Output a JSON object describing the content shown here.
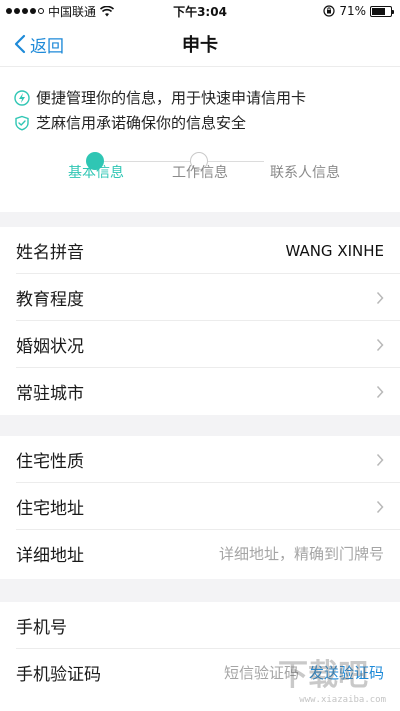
{
  "status_bar": {
    "carrier": "中国联通",
    "time": "下午3:04",
    "battery_percent": "71%",
    "battery_level": 0.71
  },
  "nav": {
    "back_label": "返回",
    "title": "申卡"
  },
  "info": {
    "line1": "便捷管理你的信息，用于快速申请信用卡",
    "line2": "芝麻信用承诺确保你的信息安全"
  },
  "steps": [
    {
      "label": "基本信息",
      "state": "active"
    },
    {
      "label": "工作信息",
      "state": "pending"
    },
    {
      "label": "联系人信息",
      "state": "pending"
    }
  ],
  "group1": {
    "rows": [
      {
        "label": "姓名拼音",
        "value": "WANG XINHE"
      },
      {
        "label": "教育程度"
      },
      {
        "label": "婚姻状况"
      },
      {
        "label": "常驻城市"
      }
    ]
  },
  "group2": {
    "rows": [
      {
        "label": "住宅性质"
      },
      {
        "label": "住宅地址"
      },
      {
        "label": "详细地址",
        "placeholder": "详细地址，精确到门牌号"
      }
    ]
  },
  "group3": {
    "rows": [
      {
        "label": "手机号"
      },
      {
        "label": "手机验证码",
        "placeholder": "短信验证码",
        "action": "发送验证码"
      }
    ]
  },
  "watermark": {
    "text": "www.xiazaiba.com"
  },
  "colors": {
    "accent_teal": "#2fc6b4",
    "link_blue": "#1e8ad8",
    "background": "#f3f3f5"
  }
}
